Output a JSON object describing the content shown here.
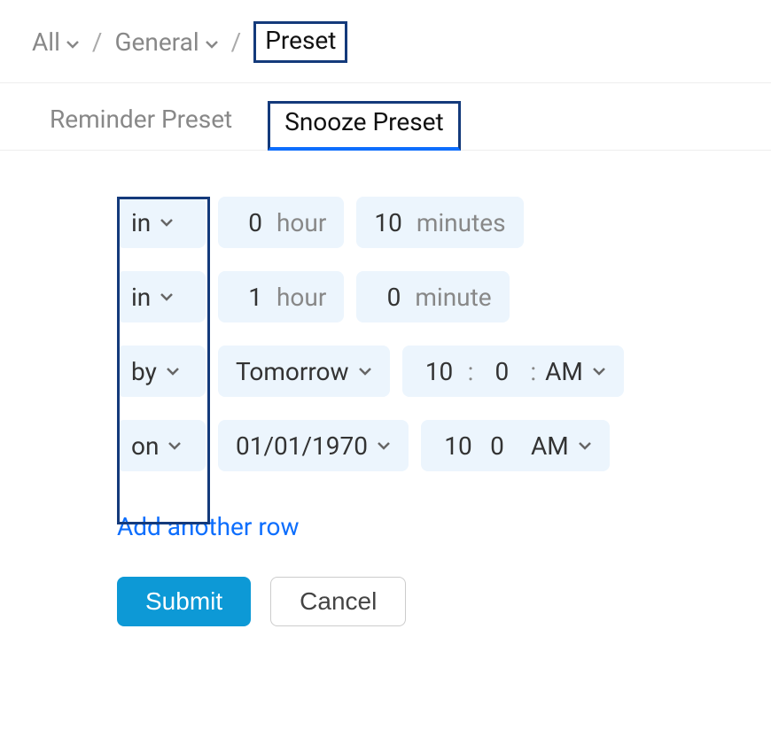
{
  "breadcrumb": {
    "all": "All",
    "general": "General",
    "current": "Preset"
  },
  "tabs": {
    "reminder": "Reminder Preset",
    "snooze": "Snooze Preset"
  },
  "rows": [
    {
      "mode": "in",
      "hours": "0",
      "hour_unit": "hour",
      "minutes": "10",
      "minute_unit": "minutes"
    },
    {
      "mode": "in",
      "hours": "1",
      "hour_unit": "hour",
      "minutes": "0",
      "minute_unit": "minute"
    },
    {
      "mode": "by",
      "day": "Tomorrow",
      "hh": "10",
      "mm": "0",
      "ampm": "AM",
      "colon": ":"
    },
    {
      "mode": "on",
      "date": "01/01/1970",
      "hh": "10",
      "mm": "0",
      "ampm": "AM"
    }
  ],
  "add_row": "Add another row",
  "buttons": {
    "submit": "Submit",
    "cancel": "Cancel"
  }
}
